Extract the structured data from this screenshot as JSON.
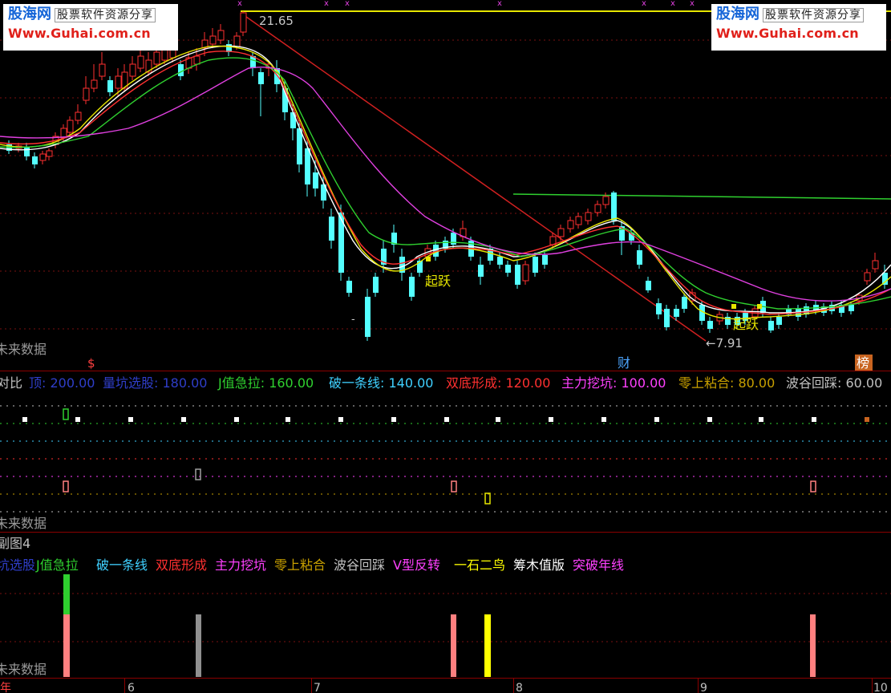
{
  "watermark": {
    "brand": "股海网",
    "tagline": "股票软件资源分享",
    "url": "Www.Guhai.com.cn"
  },
  "main_chart": {
    "high_label": "21.65",
    "low_label": "←7.91",
    "signal_label_1": "起跃",
    "signal_label_2": "起跃",
    "dash_mark": "-",
    "caption": "未来数据",
    "markers": [
      {
        "text": "$",
        "color": "#ff4040"
      },
      {
        "text": "财",
        "color": "#4da6ff"
      },
      {
        "text": "榜",
        "color": "#ffffff"
      }
    ]
  },
  "sub_chart_1": {
    "title": "对比",
    "legend": [
      {
        "text": "顶: 200.00",
        "color": "#2f3ec9"
      },
      {
        "text": "量坑选股: 180.00",
        "color": "#2f3ec9"
      },
      {
        "text": "J值急拉: 160.00",
        "color": "#2fd02f"
      },
      {
        "text": "破一条线: 140.00",
        "color": "#3fd0ff"
      },
      {
        "text": "双底形成: 120.00",
        "color": "#ff3030"
      },
      {
        "text": "主力挖坑: 100.00",
        "color": "#ff40ff"
      },
      {
        "text": "零上粘合: 80.00",
        "color": "#c8a000"
      },
      {
        "text": "波谷回踩: 60.00",
        "color": "#c0c0c0"
      }
    ],
    "caption": "未来数据"
  },
  "sub_chart_2": {
    "title": "副图4",
    "legend": [
      {
        "text": "坑选股",
        "color": "#2f3ec9"
      },
      {
        "text": "J值急拉",
        "color": "#2fd02f"
      },
      {
        "text": "破一条线",
        "color": "#3fd0ff"
      },
      {
        "text": "双底形成",
        "color": "#ff3030"
      },
      {
        "text": "主力挖坑",
        "color": "#ff40ff"
      },
      {
        "text": "零上粘合",
        "color": "#c8a000"
      },
      {
        "text": "波谷回踩",
        "color": "#c0c0c0"
      },
      {
        "text": "V型反转",
        "color": "#ff40ff"
      },
      {
        "text": "一石二鸟",
        "color": "#ffff00"
      },
      {
        "text": "筹木值版",
        "color": "#ffffff"
      },
      {
        "text": "突破年线",
        "color": "#ff40ff"
      }
    ],
    "caption": "未来数据"
  },
  "time_axis": {
    "labels": [
      "年",
      "6",
      "7",
      "8",
      "9",
      "10"
    ]
  }
}
